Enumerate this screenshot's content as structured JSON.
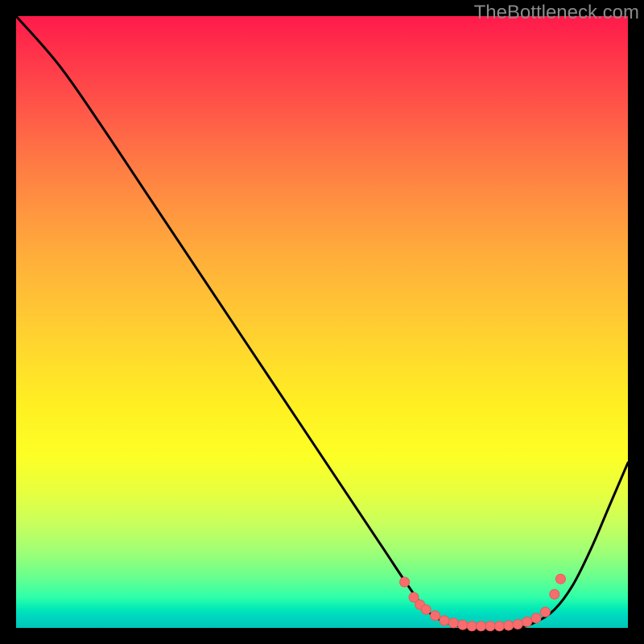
{
  "watermark": "TheBottleneck.com",
  "colors": {
    "line": "#000000",
    "dot_fill": "#f76d6d",
    "dot_stroke": "#e85a5a"
  },
  "chart_data": {
    "type": "line",
    "title": "",
    "xlabel": "",
    "ylabel": "",
    "xlim": [
      0,
      100
    ],
    "ylim": [
      0,
      100
    ],
    "series": [
      {
        "name": "curve",
        "points": [
          {
            "x": 0,
            "y": 100
          },
          {
            "x": 7,
            "y": 92
          },
          {
            "x": 14,
            "y": 82
          },
          {
            "x": 22,
            "y": 70
          },
          {
            "x": 30,
            "y": 58
          },
          {
            "x": 38,
            "y": 46
          },
          {
            "x": 46,
            "y": 34
          },
          {
            "x": 54,
            "y": 22
          },
          {
            "x": 60,
            "y": 13
          },
          {
            "x": 64,
            "y": 7
          },
          {
            "x": 67,
            "y": 3
          },
          {
            "x": 70,
            "y": 1
          },
          {
            "x": 74,
            "y": 0
          },
          {
            "x": 78,
            "y": 0
          },
          {
            "x": 82,
            "y": 0
          },
          {
            "x": 85,
            "y": 1
          },
          {
            "x": 88,
            "y": 3
          },
          {
            "x": 91,
            "y": 7
          },
          {
            "x": 94,
            "y": 13
          },
          {
            "x": 97,
            "y": 20
          },
          {
            "x": 100,
            "y": 27
          }
        ]
      }
    ],
    "dots": [
      {
        "x": 63.5,
        "y": 7.5
      },
      {
        "x": 65.0,
        "y": 5.0
      },
      {
        "x": 66.0,
        "y": 3.8
      },
      {
        "x": 67.0,
        "y": 3.0
      },
      {
        "x": 68.5,
        "y": 2.0
      },
      {
        "x": 70.0,
        "y": 1.2
      },
      {
        "x": 71.5,
        "y": 0.8
      },
      {
        "x": 73.0,
        "y": 0.5
      },
      {
        "x": 74.5,
        "y": 0.3
      },
      {
        "x": 76.0,
        "y": 0.3
      },
      {
        "x": 77.5,
        "y": 0.3
      },
      {
        "x": 79.0,
        "y": 0.3
      },
      {
        "x": 80.5,
        "y": 0.4
      },
      {
        "x": 82.0,
        "y": 0.6
      },
      {
        "x": 83.5,
        "y": 1.0
      },
      {
        "x": 85.0,
        "y": 1.6
      },
      {
        "x": 86.5,
        "y": 2.6
      },
      {
        "x": 88.0,
        "y": 5.5
      },
      {
        "x": 89.0,
        "y": 8.0
      }
    ],
    "dot_radius_px": 6
  }
}
